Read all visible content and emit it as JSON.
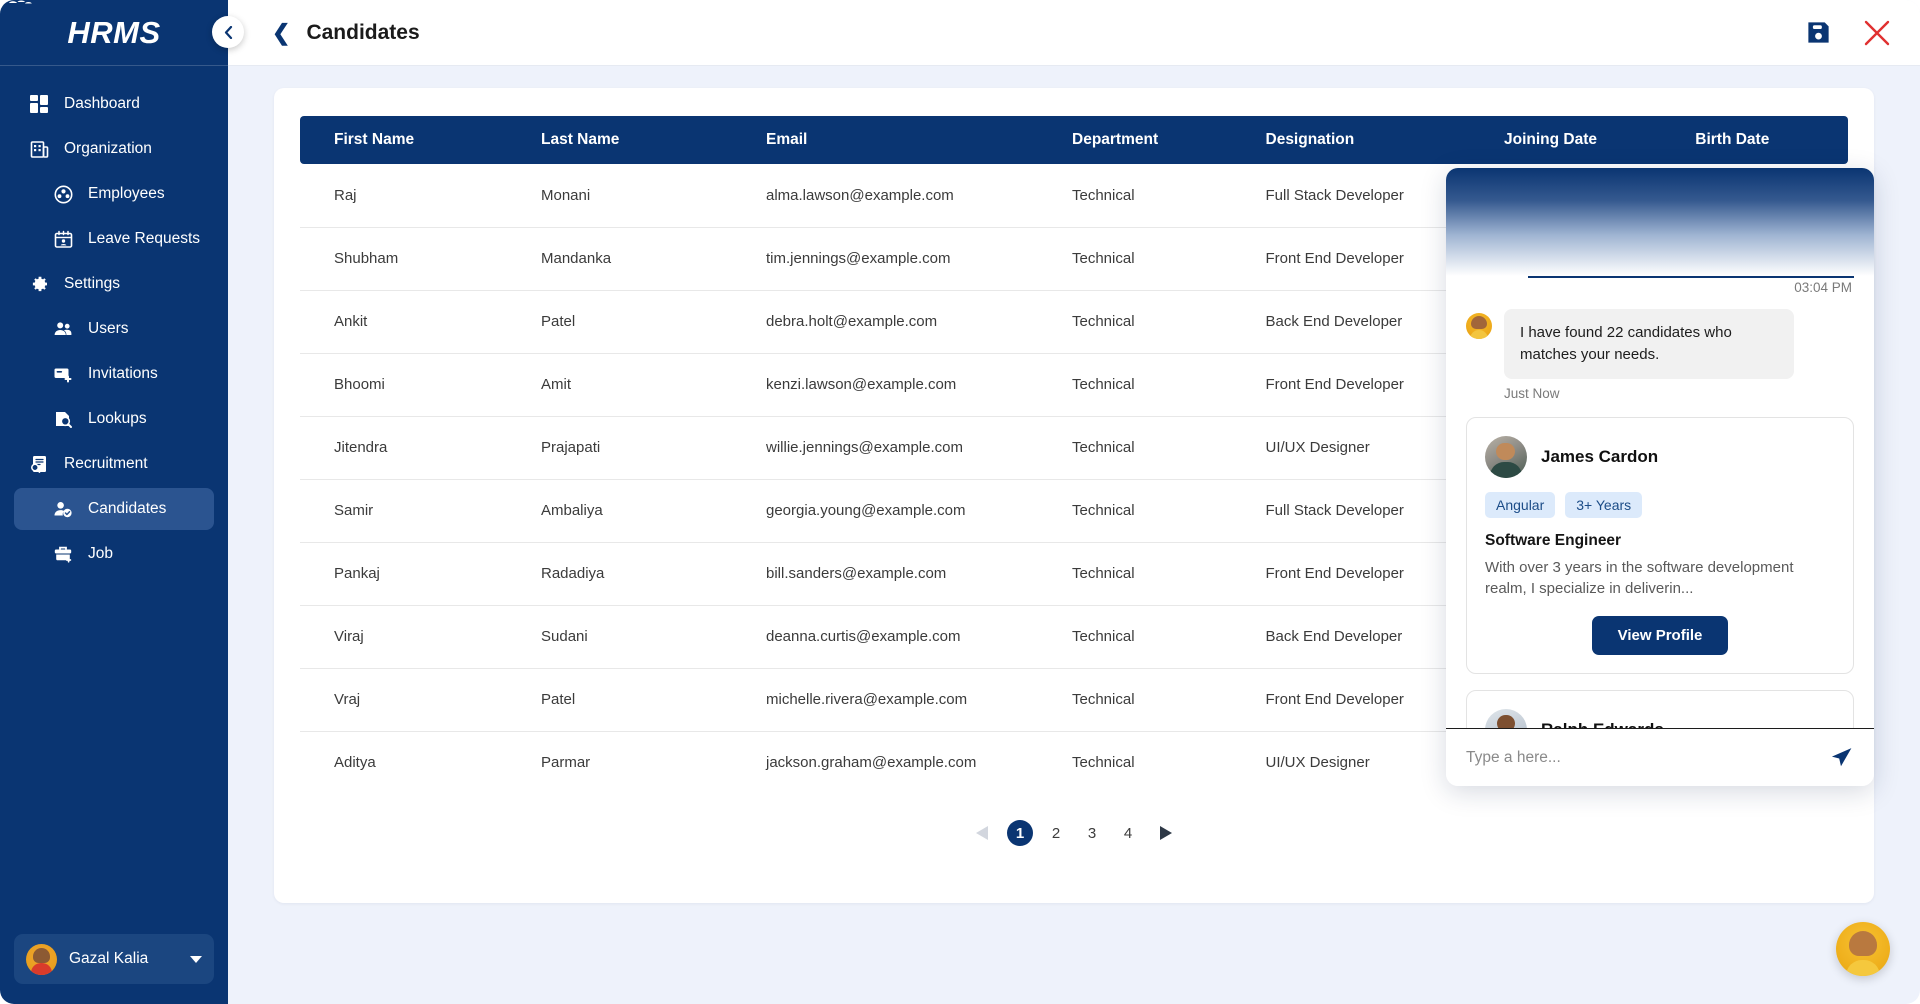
{
  "brand": {
    "name": "HRMS"
  },
  "sidebar": {
    "items": [
      {
        "label": "Dashboard",
        "icon": "dashboard-icon",
        "level": "top",
        "active": false
      },
      {
        "label": "Organization",
        "icon": "building-icon",
        "level": "top",
        "active": false
      },
      {
        "label": "Employees",
        "icon": "employees-icon",
        "level": "sub",
        "active": false
      },
      {
        "label": "Leave Requests",
        "icon": "calendar-icon",
        "level": "sub",
        "active": false
      },
      {
        "label": "Settings",
        "icon": "gear-icon",
        "level": "top",
        "active": false
      },
      {
        "label": "Users",
        "icon": "users-icon",
        "level": "sub",
        "active": false
      },
      {
        "label": "Invitations",
        "icon": "invitation-icon",
        "level": "sub",
        "active": false
      },
      {
        "label": "Lookups",
        "icon": "lookup-icon",
        "level": "sub",
        "active": false
      },
      {
        "label": "Recruitment",
        "icon": "recruitment-icon",
        "level": "top",
        "active": false
      },
      {
        "label": "Candidates",
        "icon": "candidates-icon",
        "level": "sub",
        "active": true
      },
      {
        "label": "Job",
        "icon": "briefcase-icon",
        "level": "sub",
        "active": false
      }
    ],
    "collapse_icon": "chevron-left-icon",
    "user": {
      "name": "Gazal Kalia",
      "avatar": "user-avatar",
      "caret": "chevron-down-icon"
    }
  },
  "header": {
    "back_icon": "chevron-left-icon",
    "title": "Candidates",
    "save_icon": "save-icon",
    "close_icon": "close-icon",
    "accent": "#0a3572",
    "close_color": "#e03030"
  },
  "table": {
    "columns": [
      "First Name",
      "Last Name",
      "Email",
      "Department",
      "Designation",
      "Joining Date",
      "Birth Date"
    ],
    "rows": [
      {
        "first_name": "Raj",
        "last_name": "Monani",
        "email": "alma.lawson@example.com",
        "department": "Technical",
        "designation": "Full Stack Developer",
        "joining_date": "",
        "birth_date": ""
      },
      {
        "first_name": "Shubham",
        "last_name": "Mandanka",
        "email": "tim.jennings@example.com",
        "department": "Technical",
        "designation": "Front End Developer",
        "joining_date": "",
        "birth_date": ""
      },
      {
        "first_name": "Ankit",
        "last_name": "Patel",
        "email": "debra.holt@example.com",
        "department": "Technical",
        "designation": "Back End Developer",
        "joining_date": "",
        "birth_date": ""
      },
      {
        "first_name": "Bhoomi",
        "last_name": "Amit",
        "email": "kenzi.lawson@example.com",
        "department": "Technical",
        "designation": "Front End Developer",
        "joining_date": "",
        "birth_date": ""
      },
      {
        "first_name": "Jitendra",
        "last_name": "Prajapati",
        "email": "willie.jennings@example.com",
        "department": "Technical",
        "designation": "UI/UX Designer",
        "joining_date": "",
        "birth_date": ""
      },
      {
        "first_name": "Samir",
        "last_name": "Ambaliya",
        "email": "georgia.young@example.com",
        "department": "Technical",
        "designation": "Full Stack Developer",
        "joining_date": "",
        "birth_date": ""
      },
      {
        "first_name": "Pankaj",
        "last_name": "Radadiya",
        "email": "bill.sanders@example.com",
        "department": "Technical",
        "designation": "Front End Developer",
        "joining_date": "",
        "birth_date": ""
      },
      {
        "first_name": "Viraj",
        "last_name": "Sudani",
        "email": "deanna.curtis@example.com",
        "department": "Technical",
        "designation": "Back End Developer",
        "joining_date": "",
        "birth_date": ""
      },
      {
        "first_name": "Vraj",
        "last_name": "Patel",
        "email": "michelle.rivera@example.com",
        "department": "Technical",
        "designation": "Front End Developer",
        "joining_date": "",
        "birth_date": ""
      },
      {
        "first_name": "Aditya",
        "last_name": "Parmar",
        "email": "jackson.graham@example.com",
        "department": "Technical",
        "designation": "UI/UX Designer",
        "joining_date": "",
        "birth_date": ""
      }
    ]
  },
  "pagination": {
    "prev_icon": "triangle-left-icon",
    "next_icon": "triangle-right-icon",
    "pages": [
      "1",
      "2",
      "3",
      "4"
    ],
    "current": "1"
  },
  "chat": {
    "sent_time": "03:04 PM",
    "bot_message": "I have found 22 candidates who matches your needs.",
    "bot_message_time": "Just Now",
    "bot_avatar": "assistant-avatar",
    "cards": [
      {
        "name": "James Cardon",
        "avatar": "candidate-avatar",
        "tags": [
          "Angular",
          "3+ Years"
        ],
        "role": "Software Engineer",
        "description": "With over 3 years in the software development realm, I specialize in deliverin...",
        "button": "View Profile"
      },
      {
        "name": "Ralph Edwards",
        "avatar": "candidate-avatar"
      }
    ],
    "input_placeholder": "Type a here...",
    "input_value": "",
    "send_icon": "send-icon"
  },
  "fab": {
    "icon": "assistant-avatar"
  }
}
